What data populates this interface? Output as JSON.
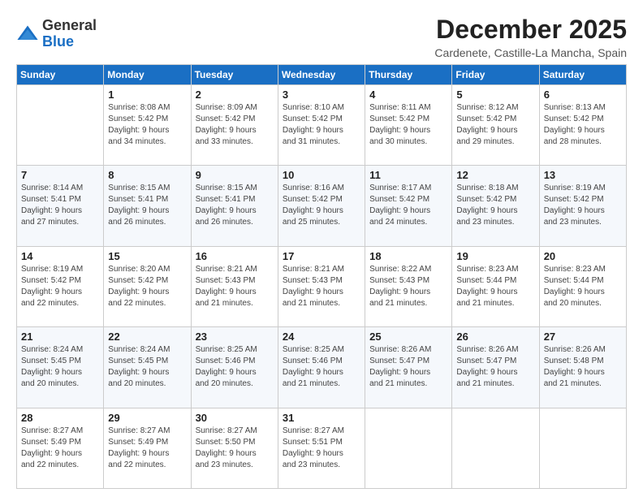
{
  "logo": {
    "general": "General",
    "blue": "Blue"
  },
  "title": "December 2025",
  "subtitle": "Cardenete, Castille-La Mancha, Spain",
  "days_header": [
    "Sunday",
    "Monday",
    "Tuesday",
    "Wednesday",
    "Thursday",
    "Friday",
    "Saturday"
  ],
  "weeks": [
    [
      {
        "day": "",
        "detail": ""
      },
      {
        "day": "1",
        "detail": "Sunrise: 8:08 AM\nSunset: 5:42 PM\nDaylight: 9 hours\nand 34 minutes."
      },
      {
        "day": "2",
        "detail": "Sunrise: 8:09 AM\nSunset: 5:42 PM\nDaylight: 9 hours\nand 33 minutes."
      },
      {
        "day": "3",
        "detail": "Sunrise: 8:10 AM\nSunset: 5:42 PM\nDaylight: 9 hours\nand 31 minutes."
      },
      {
        "day": "4",
        "detail": "Sunrise: 8:11 AM\nSunset: 5:42 PM\nDaylight: 9 hours\nand 30 minutes."
      },
      {
        "day": "5",
        "detail": "Sunrise: 8:12 AM\nSunset: 5:42 PM\nDaylight: 9 hours\nand 29 minutes."
      },
      {
        "day": "6",
        "detail": "Sunrise: 8:13 AM\nSunset: 5:42 PM\nDaylight: 9 hours\nand 28 minutes."
      }
    ],
    [
      {
        "day": "7",
        "detail": "Sunrise: 8:14 AM\nSunset: 5:41 PM\nDaylight: 9 hours\nand 27 minutes."
      },
      {
        "day": "8",
        "detail": "Sunrise: 8:15 AM\nSunset: 5:41 PM\nDaylight: 9 hours\nand 26 minutes."
      },
      {
        "day": "9",
        "detail": "Sunrise: 8:15 AM\nSunset: 5:41 PM\nDaylight: 9 hours\nand 26 minutes."
      },
      {
        "day": "10",
        "detail": "Sunrise: 8:16 AM\nSunset: 5:42 PM\nDaylight: 9 hours\nand 25 minutes."
      },
      {
        "day": "11",
        "detail": "Sunrise: 8:17 AM\nSunset: 5:42 PM\nDaylight: 9 hours\nand 24 minutes."
      },
      {
        "day": "12",
        "detail": "Sunrise: 8:18 AM\nSunset: 5:42 PM\nDaylight: 9 hours\nand 23 minutes."
      },
      {
        "day": "13",
        "detail": "Sunrise: 8:19 AM\nSunset: 5:42 PM\nDaylight: 9 hours\nand 23 minutes."
      }
    ],
    [
      {
        "day": "14",
        "detail": "Sunrise: 8:19 AM\nSunset: 5:42 PM\nDaylight: 9 hours\nand 22 minutes."
      },
      {
        "day": "15",
        "detail": "Sunrise: 8:20 AM\nSunset: 5:42 PM\nDaylight: 9 hours\nand 22 minutes."
      },
      {
        "day": "16",
        "detail": "Sunrise: 8:21 AM\nSunset: 5:43 PM\nDaylight: 9 hours\nand 21 minutes."
      },
      {
        "day": "17",
        "detail": "Sunrise: 8:21 AM\nSunset: 5:43 PM\nDaylight: 9 hours\nand 21 minutes."
      },
      {
        "day": "18",
        "detail": "Sunrise: 8:22 AM\nSunset: 5:43 PM\nDaylight: 9 hours\nand 21 minutes."
      },
      {
        "day": "19",
        "detail": "Sunrise: 8:23 AM\nSunset: 5:44 PM\nDaylight: 9 hours\nand 21 minutes."
      },
      {
        "day": "20",
        "detail": "Sunrise: 8:23 AM\nSunset: 5:44 PM\nDaylight: 9 hours\nand 20 minutes."
      }
    ],
    [
      {
        "day": "21",
        "detail": "Sunrise: 8:24 AM\nSunset: 5:45 PM\nDaylight: 9 hours\nand 20 minutes."
      },
      {
        "day": "22",
        "detail": "Sunrise: 8:24 AM\nSunset: 5:45 PM\nDaylight: 9 hours\nand 20 minutes."
      },
      {
        "day": "23",
        "detail": "Sunrise: 8:25 AM\nSunset: 5:46 PM\nDaylight: 9 hours\nand 20 minutes."
      },
      {
        "day": "24",
        "detail": "Sunrise: 8:25 AM\nSunset: 5:46 PM\nDaylight: 9 hours\nand 21 minutes."
      },
      {
        "day": "25",
        "detail": "Sunrise: 8:26 AM\nSunset: 5:47 PM\nDaylight: 9 hours\nand 21 minutes."
      },
      {
        "day": "26",
        "detail": "Sunrise: 8:26 AM\nSunset: 5:47 PM\nDaylight: 9 hours\nand 21 minutes."
      },
      {
        "day": "27",
        "detail": "Sunrise: 8:26 AM\nSunset: 5:48 PM\nDaylight: 9 hours\nand 21 minutes."
      }
    ],
    [
      {
        "day": "28",
        "detail": "Sunrise: 8:27 AM\nSunset: 5:49 PM\nDaylight: 9 hours\nand 22 minutes."
      },
      {
        "day": "29",
        "detail": "Sunrise: 8:27 AM\nSunset: 5:49 PM\nDaylight: 9 hours\nand 22 minutes."
      },
      {
        "day": "30",
        "detail": "Sunrise: 8:27 AM\nSunset: 5:50 PM\nDaylight: 9 hours\nand 23 minutes."
      },
      {
        "day": "31",
        "detail": "Sunrise: 8:27 AM\nSunset: 5:51 PM\nDaylight: 9 hours\nand 23 minutes."
      },
      {
        "day": "",
        "detail": ""
      },
      {
        "day": "",
        "detail": ""
      },
      {
        "day": "",
        "detail": ""
      }
    ]
  ]
}
